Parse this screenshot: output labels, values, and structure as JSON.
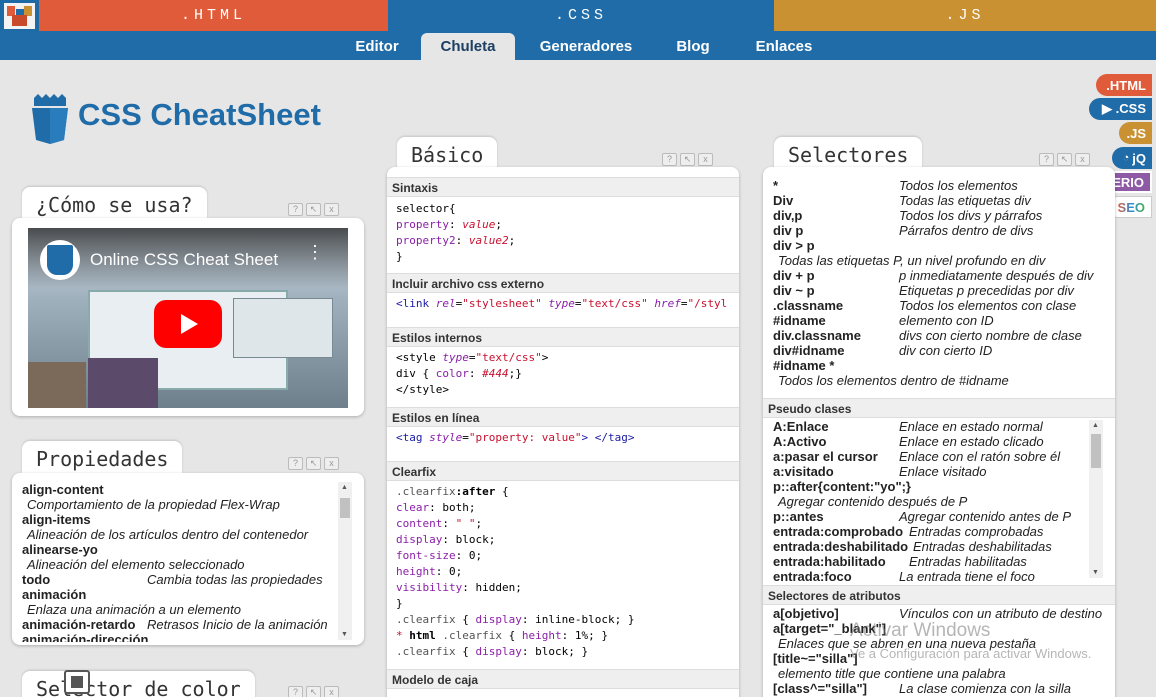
{
  "lang_tabs": [
    ".HTML",
    ".CSS",
    ".JS"
  ],
  "nav": [
    "Editor",
    "Chuleta",
    "Generadores",
    "Blog",
    "Enlaces"
  ],
  "site_title": "CSS CheatSheet",
  "badges": [
    ".HTML",
    "▶ .CSS",
    ".JS",
    "jQ",
    "AMPERIO",
    "SEO"
  ],
  "colors": {
    "html": "#e05b3a",
    "css": "#1f6ca8",
    "js": "#c99131",
    "amperio": "#8e5aa6",
    "seo": "#2a8fd6"
  },
  "panel_controls": [
    "?",
    "↖",
    "x"
  ],
  "como": {
    "tab": "¿Cómo se usa?",
    "video_title": "Online CSS Cheat Sheet",
    "video_icon": "youtube-play-icon"
  },
  "propiedades": {
    "tab": "Propiedades",
    "rows": [
      {
        "sel": "align-content",
        "desc": ""
      },
      {
        "sub": "Comportamiento de la propiedad Flex-Wrap"
      },
      {
        "sel": "align-items",
        "desc": ""
      },
      {
        "sub": "Alineación de los artículos dentro del contenedor"
      },
      {
        "sel": "alinearse-yo",
        "desc": ""
      },
      {
        "sub": "Alineación del elemento seleccionado"
      },
      {
        "sel": "todo",
        "desc": "Cambia todas las propiedades"
      },
      {
        "sel": "animación",
        "desc": ""
      },
      {
        "sub": "Enlaza una animación a un elemento"
      },
      {
        "sel": "animación-retardo",
        "desc": "Retrasos Inicio de la animación"
      },
      {
        "sel": "animación-dirección",
        "desc": ""
      }
    ]
  },
  "selector_color": {
    "tab": "Selector de color"
  },
  "basico": {
    "tab": "Básico",
    "sections": {
      "sintaxis": "Sintaxis",
      "externo": "Incluir archivo css externo",
      "internos": "Estilos internos",
      "linea": "Estilos en línea",
      "clearfix": "Clearfix",
      "caja": "Modelo de caja"
    },
    "code": {
      "s1": "selector{",
      "s2p": "property",
      "s2v": "value",
      "s3p": "property2",
      "s3v": "value2",
      "s4": "}",
      "link_tag": "<link",
      "link_rel_a": "rel",
      "link_rel_v": "\"stylesheet\"",
      "link_type_a": "type",
      "link_type_v": "\"text/css\"",
      "link_href_a": "href",
      "link_href_v": "\"/styl",
      "style_open": "<style",
      "style_type_a": "type",
      "style_type_v": "\"text/css\"",
      "style_close_br": ">",
      "div_sel": "div",
      "div_prop": "color",
      "div_val": "#444",
      "style_end": "</style>",
      "tag_open": "<tag",
      "tag_style_a": "style",
      "tag_style_v": "\"property: value\"",
      "tag_close": "> </tag>",
      "cf1a": ".clearfix",
      "cf1b": ":after",
      "cf1c": " {",
      "cf_lines": [
        [
          "clear",
          "both"
        ],
        [
          "content",
          "\" \""
        ],
        [
          "display",
          "block"
        ],
        [
          "font-size",
          "0"
        ],
        [
          "height",
          "0"
        ],
        [
          "visibility",
          "hidden"
        ]
      ],
      "cf_close": "}",
      "cf2a": ".clearfix",
      "cf2p": "display",
      "cf2v": "inline-block",
      "cf3star": "*",
      "cf3html": "html",
      "cf3a": ".clearfix",
      "cf3p": "height",
      "cf3v": "1%",
      "cf4a": ".clearfix",
      "cf4p": "display",
      "cf4v": "block"
    }
  },
  "selectores": {
    "tab": "Selectores",
    "rows": [
      {
        "sel": "*",
        "desc": "Todos los elementos"
      },
      {
        "sel": "Div",
        "desc": "Todas las etiquetas div"
      },
      {
        "sel": "div,p",
        "desc": "Todos los divs y párrafos"
      },
      {
        "sel": "div p",
        "desc": "Párrafos dentro de divs"
      },
      {
        "sel": "div > p",
        "desc": ""
      },
      {
        "sub": "Todas las etiquetas P, un nivel profundo en div"
      },
      {
        "sel": "div + p",
        "desc": "p inmediatamente después de div"
      },
      {
        "sel": "div ~ p",
        "desc": "Etiquetas p precedidas por div"
      },
      {
        "sel": ".classname",
        "desc": "Todos los elementos con clase"
      },
      {
        "sel": "#idname",
        "desc": "elemento con ID"
      },
      {
        "sel": "div.classname",
        "desc": "divs con cierto nombre de clase"
      },
      {
        "sel": "div#idname",
        "desc": "div con cierto ID"
      },
      {
        "sel": "#idname *",
        "desc": ""
      },
      {
        "sub": "Todos los elementos dentro de #idname"
      }
    ],
    "pseudo_head": "Pseudo clases",
    "pseudo_rows": [
      {
        "sel": "A:Enlace",
        "desc": "Enlace en estado normal"
      },
      {
        "sel": "A:Activo",
        "desc": "Enlace en estado clicado"
      },
      {
        "sel": "a:pasar el cursor",
        "desc": "Enlace con el ratón sobre él"
      },
      {
        "sel": "a:visitado",
        "desc": "Enlace visitado"
      },
      {
        "sel": "p::after{content:\"yo\";}",
        "desc": ""
      },
      {
        "sub": "Agregar contenido después de P"
      },
      {
        "sel": "p::antes",
        "desc": "Agregar contenido antes de P"
      },
      {
        "sel": "entrada:comprobado",
        "desc": "Entradas comprobadas"
      },
      {
        "sel": "entrada:deshabilitado",
        "desc": "Entradas deshabilitadas"
      },
      {
        "sel": "entrada:habilitado",
        "desc": "Entradas habilitadas"
      },
      {
        "sel": "entrada:foco",
        "desc": "La entrada tiene el foco"
      }
    ],
    "attr_head": "Selectores de atributos",
    "attr_rows": [
      {
        "sel": "a[objetivo]",
        "desc": "Vínculos con un atributo de destino"
      },
      {
        "sel": "a[target=\"_blank\"]",
        "desc": ""
      },
      {
        "sub": "Enlaces que se abren en una nueva pestaña"
      },
      {
        "sel": "[title~=\"silla\"]",
        "desc": ""
      },
      {
        "sub": "elemento title que contiene una palabra"
      },
      {
        "sel": "[class^=\"silla\"]",
        "desc": "La clase comienza con la silla"
      }
    ]
  },
  "watermark": {
    "line1": "Activar Windows",
    "line2": "Ve a Configuración para activar Windows."
  }
}
